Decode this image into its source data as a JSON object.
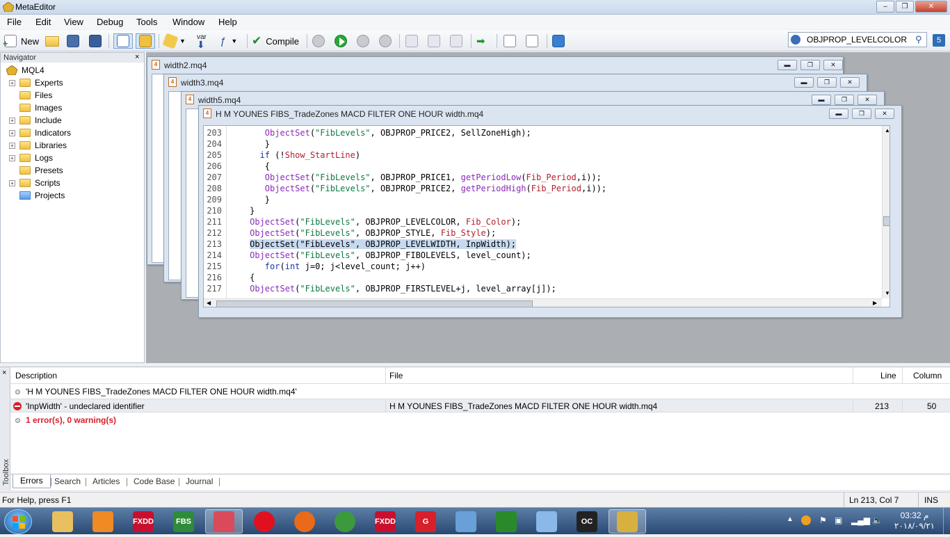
{
  "window": {
    "title": "MetaEditor",
    "minimize": "–",
    "maximize": "❐",
    "close": "✕"
  },
  "menu": [
    "File",
    "Edit",
    "View",
    "Debug",
    "Tools",
    "Window",
    "Help"
  ],
  "toolbar": {
    "new_label": "New",
    "var_label": "var",
    "compile_label": "Compile"
  },
  "search": {
    "value": "OBJPROP_LEVELCOLOR",
    "badge": "5"
  },
  "navigator": {
    "title": "Navigator",
    "close": "×",
    "root": "MQL4",
    "items": [
      {
        "label": "Experts",
        "expandable": true
      },
      {
        "label": "Files",
        "expandable": false
      },
      {
        "label": "Images",
        "expandable": false
      },
      {
        "label": "Include",
        "expandable": true
      },
      {
        "label": "Indicators",
        "expandable": true
      },
      {
        "label": "Libraries",
        "expandable": true
      },
      {
        "label": "Logs",
        "expandable": true
      },
      {
        "label": "Presets",
        "expandable": false
      },
      {
        "label": "Scripts",
        "expandable": true
      },
      {
        "label": "Projects",
        "expandable": false
      }
    ]
  },
  "documents": [
    {
      "title": "width2.mq4"
    },
    {
      "title": "width3.mq4"
    },
    {
      "title": "width5.mq4"
    },
    {
      "title": "H M YOUNES FIBS_TradeZones MACD FILTER ONE HOUR width.mq4"
    }
  ],
  "code": [
    {
      "n": "203",
      "t": "        ObjectSet(\"FibLevels\", OBJPROP_PRICE2, SellZoneHigh);"
    },
    {
      "n": "204",
      "t": "        }"
    },
    {
      "n": "205",
      "t": "       if (!Show_StartLine)"
    },
    {
      "n": "206",
      "t": "        {"
    },
    {
      "n": "207",
      "t": "        ObjectSet(\"FibLevels\", OBJPROP_PRICE1, getPeriodLow(Fib_Period,i));"
    },
    {
      "n": "208",
      "t": "        ObjectSet(\"FibLevels\", OBJPROP_PRICE2, getPeriodHigh(Fib_Period,i));"
    },
    {
      "n": "209",
      "t": "        }"
    },
    {
      "n": "210",
      "t": "     }"
    },
    {
      "n": "211",
      "t": "     ObjectSet(\"FibLevels\", OBJPROP_LEVELCOLOR, Fib_Color);"
    },
    {
      "n": "212",
      "t": "     ObjectSet(\"FibLevels\", OBJPROP_STYLE, Fib_Style);"
    },
    {
      "n": "213",
      "t": "     ObjectSet(\"FibLevels\", OBJPROP_LEVELWIDTH, InpWidth);"
    },
    {
      "n": "214",
      "t": "     ObjectSet(\"FibLevels\", OBJPROP_FIBOLEVELS, level_count);"
    },
    {
      "n": "215",
      "t": "        for(int j=0; j<level_count; j++)"
    },
    {
      "n": "216",
      "t": "     {"
    },
    {
      "n": "217",
      "t": "     ObjectSet(\"FibLevels\", OBJPROP_FIRSTLEVEL+j, level_array[j]);"
    }
  ],
  "toolbox": {
    "label": "Toolbox",
    "close": "×",
    "columns": {
      "description": "Description",
      "file": "File",
      "line": "Line",
      "column": "Column"
    },
    "rows": [
      {
        "type": "info",
        "description": "'H M YOUNES FIBS_TradeZones MACD FILTER ONE HOUR width.mq4'",
        "file": "",
        "line": "",
        "column": ""
      },
      {
        "type": "error",
        "description": "'InpWidth' - undeclared identifier",
        "file": "H M YOUNES FIBS_TradeZones MACD FILTER ONE HOUR width.mq4",
        "line": "213",
        "column": "50"
      },
      {
        "type": "summary",
        "description": "1 error(s), 0 warning(s)",
        "file": "",
        "line": "",
        "column": ""
      }
    ],
    "tabs": [
      "Errors",
      "Search",
      "Articles",
      "Code Base",
      "Journal"
    ]
  },
  "status": {
    "help": "For Help, press F1",
    "position": "Ln 213, Col 7",
    "mode": "INS"
  },
  "taskbar": {
    "apps": [
      {
        "name": "explorer-icon",
        "label": "",
        "color": "#e8c060"
      },
      {
        "name": "media-player-icon",
        "label": "",
        "color": "#f08a24"
      },
      {
        "name": "fxdd-icon",
        "label": "FXDD",
        "color": "#c8102e"
      },
      {
        "name": "fbs-icon",
        "label": "FBS",
        "color": "#2e8b3a"
      },
      {
        "name": "snipping-tool-icon",
        "label": "",
        "color": "#d94a5a"
      },
      {
        "name": "opera-icon",
        "label": "",
        "color": "#e0101e"
      },
      {
        "name": "firefox-icon",
        "label": "",
        "color": "#e86a1a"
      },
      {
        "name": "chrome-icon",
        "label": "",
        "color": "#3c9a3c"
      },
      {
        "name": "fxdd-icon-2",
        "label": "FXDD",
        "color": "#c8102e"
      },
      {
        "name": "app-g-icon",
        "label": "G",
        "color": "#d6202a"
      },
      {
        "name": "network-icon",
        "label": "",
        "color": "#6aa0d8"
      },
      {
        "name": "leaf-icon",
        "label": "",
        "color": "#2a8a2a"
      },
      {
        "name": "notes-icon",
        "label": "",
        "color": "#8ab8e8"
      },
      {
        "name": "oc-icon",
        "label": "OC",
        "color": "#222222"
      },
      {
        "name": "metaeditor-icon",
        "label": "",
        "color": "#d8b040"
      }
    ],
    "clock_time": "03:32 م",
    "clock_date": "٢٠١٨/٠٩/٢١"
  }
}
